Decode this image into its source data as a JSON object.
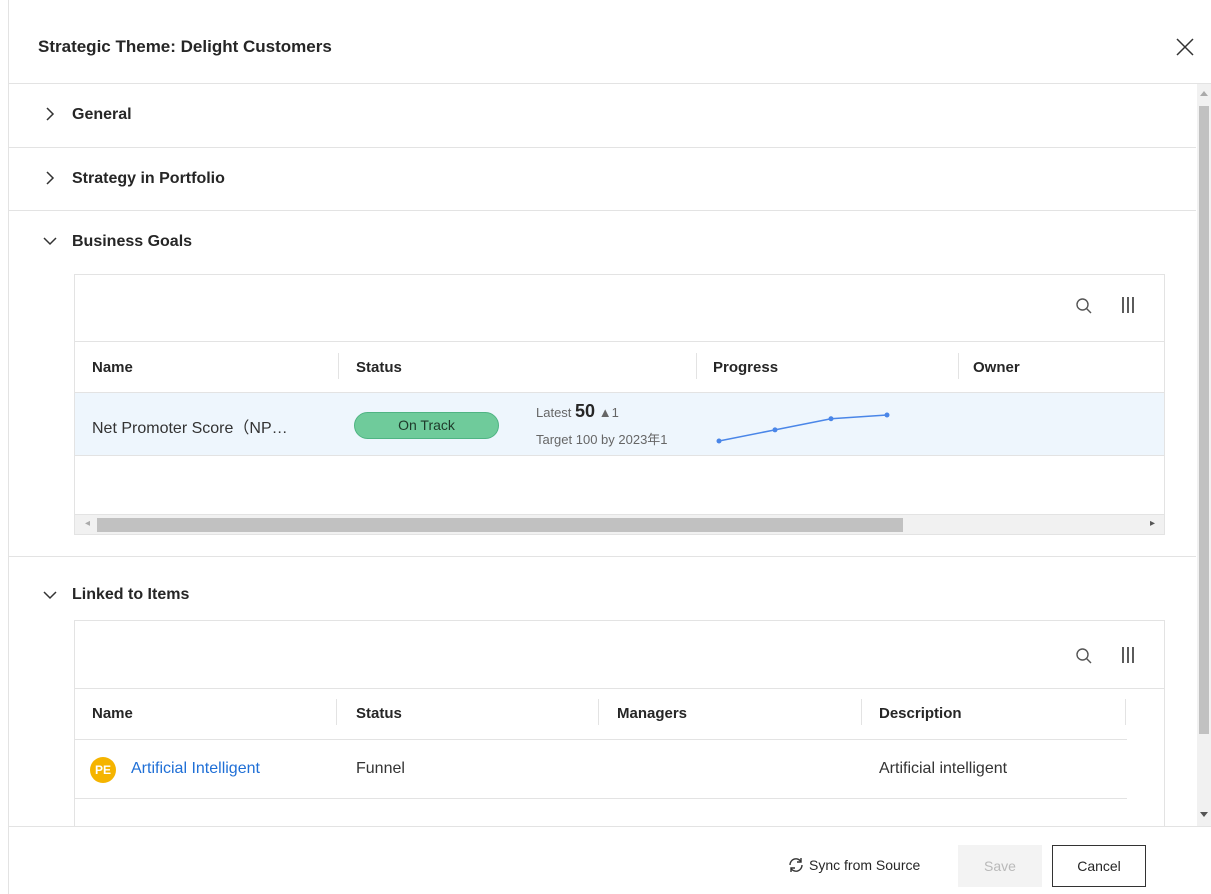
{
  "dialog": {
    "title": "Strategic Theme: Delight Customers",
    "close_icon": "close-icon"
  },
  "sections": {
    "general": {
      "label": "General",
      "expanded": false
    },
    "strategy": {
      "label": "Strategy in Portfolio",
      "expanded": false
    },
    "business_goals": {
      "label": "Business Goals",
      "expanded": true,
      "columns": [
        "Name",
        "Status",
        "Progress",
        "Owner"
      ],
      "rows": [
        {
          "name": "Net Promoter Score（NP…",
          "status": "On Track",
          "latest_label": "Latest",
          "latest_value": "50",
          "latest_delta": "▲1",
          "target": "Target  100 by 2023年1",
          "progress_series": [
            40,
            43,
            46,
            47
          ]
        }
      ],
      "scroll_left_icon": "◂",
      "scroll_right_icon": "▸"
    },
    "linked_items": {
      "label": "Linked to Items",
      "expanded": true,
      "columns": [
        "Name",
        "Status",
        "Managers",
        "Description"
      ],
      "rows": [
        {
          "avatar": "PE",
          "name": "Artificial Intelligent",
          "status": "Funnel",
          "managers": "",
          "description": "Artificial intelligent"
        }
      ]
    }
  },
  "footer": {
    "sync_label": "Sync from Source",
    "save_label": "Save",
    "cancel_label": "Cancel"
  },
  "colors": {
    "accent": "#1f6fd6",
    "on_track": "#6fcb9b",
    "avatar": "#f5b400",
    "sparkline": "#4a86e8"
  }
}
